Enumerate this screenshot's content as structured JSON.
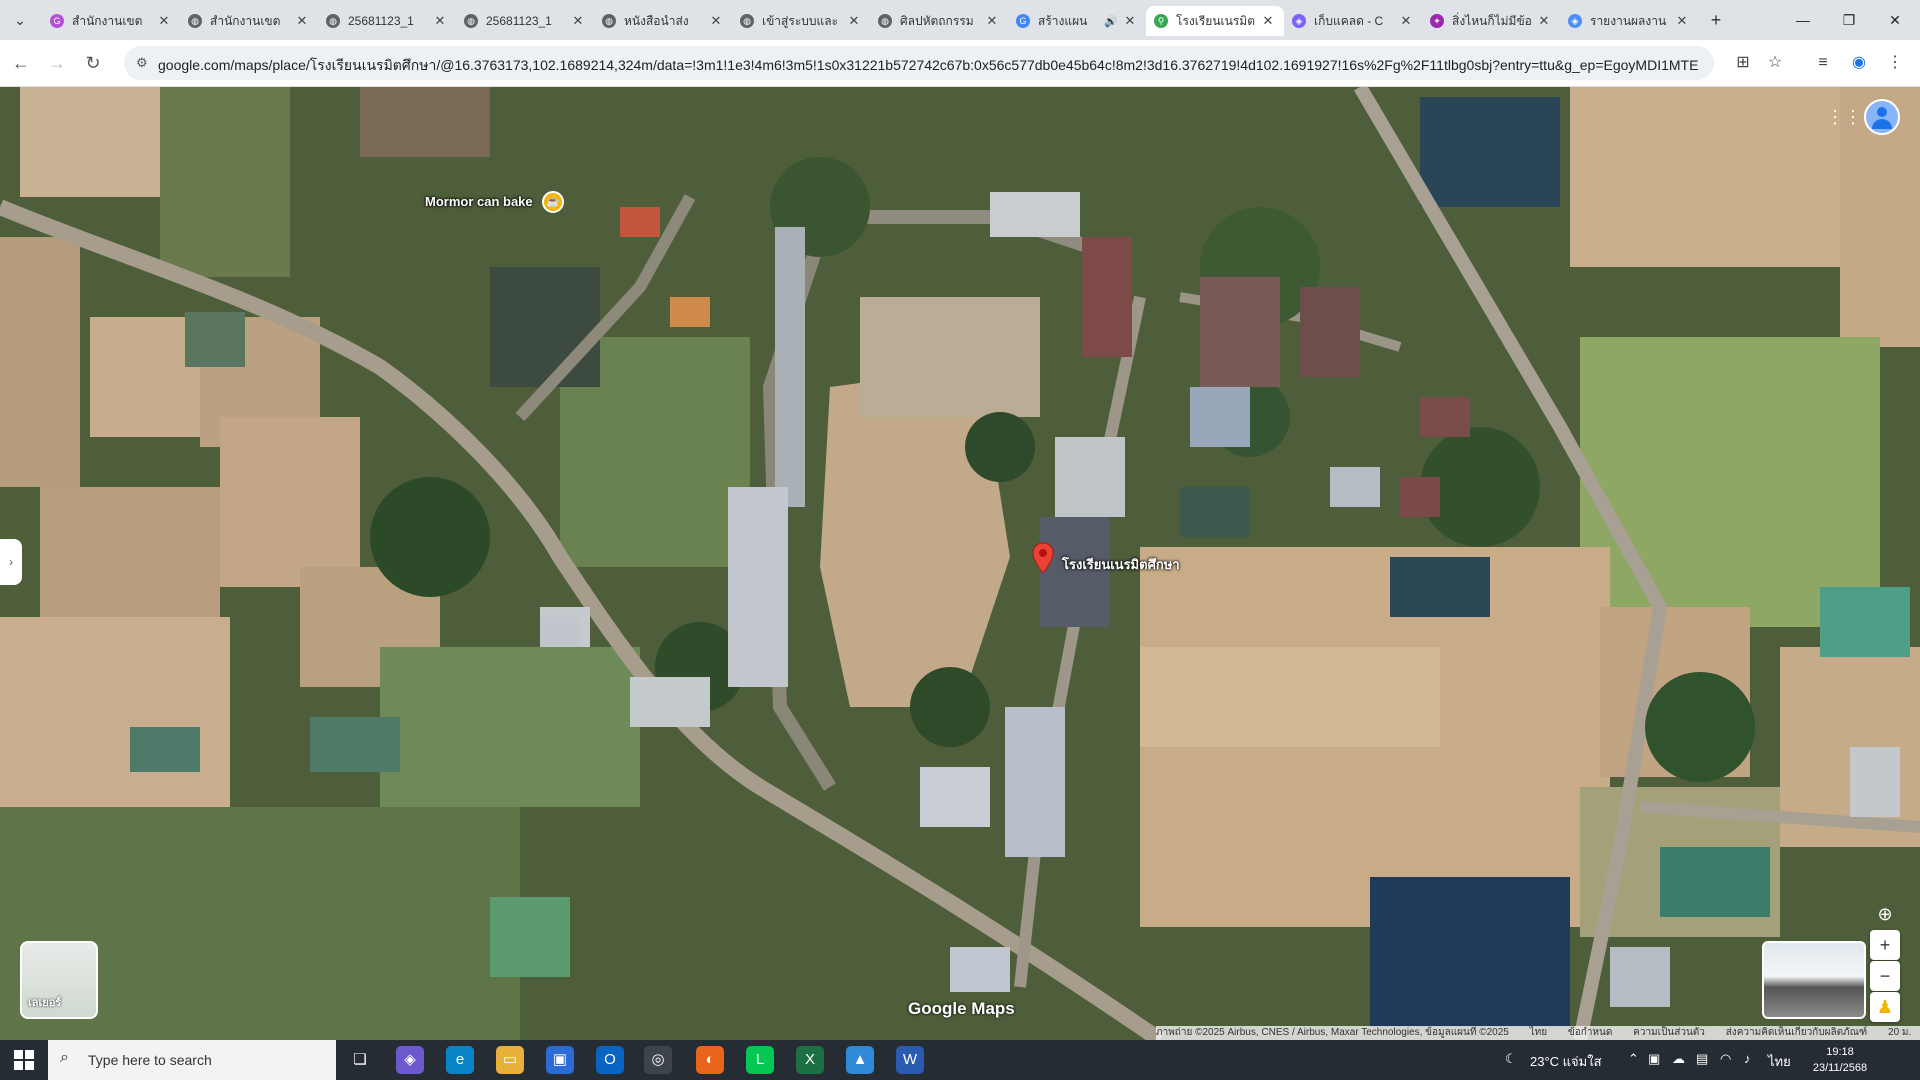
{
  "browser": {
    "tabs": [
      {
        "title": "สำนักงานเขต",
        "icon": "grammarly-icon",
        "color": "#b44fd6"
      },
      {
        "title": "สำนักงานเขต",
        "icon": "globe-icon",
        "color": "#5f6368"
      },
      {
        "title": "25681123_1",
        "icon": "globe-icon",
        "color": "#5f6368"
      },
      {
        "title": "25681123_1",
        "icon": "globe-icon",
        "color": "#5f6368"
      },
      {
        "title": "หนังสือนำส่ง",
        "icon": "globe-icon",
        "color": "#5f6368"
      },
      {
        "title": "เข้าสู่ระบบและ",
        "icon": "globe-icon",
        "color": "#5f6368"
      },
      {
        "title": "ศิลปหัตถกรรม",
        "icon": "globe-icon",
        "color": "#5f6368"
      },
      {
        "title": "สร้างแผน",
        "icon": "google-icon",
        "color": "#4285f4"
      },
      {
        "title": "โรงเรียนเนรมิต",
        "icon": "maps-icon",
        "color": "#34a853"
      },
      {
        "title": "เก็บแคลด - C",
        "icon": "copilot-icon",
        "color": "#7b61ff"
      },
      {
        "title": "สิ่งไหนก็ไม่มีข้อ",
        "icon": "chat-icon",
        "color": "#9c27b0"
      },
      {
        "title": "รายงานผลงาน",
        "icon": "copilot-icon",
        "color": "#4f8ef7"
      }
    ],
    "active_tab_index": 8,
    "url": "google.com/maps/place/โรงเรียนเนรมิตศึกษา/@16.3763173,102.1689214,324m/data=!3m1!1e3!4m6!3m5!1s0x31221b572742c67b:0x56c577db0e45b64c!8m2!3d16.3762719!4d102.1691927!16s%2Fg%2F11tlbg0sbj?entry=ttu&g_ep=EgoyMDI1MTExNy4wIKXMDSoASAFQAw%3D%3D"
  },
  "map": {
    "place_label": "โรงเรียนเนรมิตศึกษา",
    "poi_label": "Mormor can bake",
    "layers_label": "เลเยอร์",
    "logo": "Google Maps",
    "attribution": {
      "imagery": "ภาพถ่าย ©2025 Airbus, CNES / Airbus, Maxar Technologies, ข้อมูลแผนที่ ©2025",
      "lang": "ไทย",
      "terms": "ข้อกำหนด",
      "privacy": "ความเป็นส่วนตัว",
      "feedback": "ส่งความคิดเห็นเกี่ยวกับผลิตภัณฑ์",
      "scale": "20 ม."
    }
  },
  "taskbar": {
    "search_placeholder": "Type here to search",
    "weather": "23°C แจ่มใส",
    "lang": "ไทย",
    "time": "19:18",
    "date": "23/11/2568"
  }
}
